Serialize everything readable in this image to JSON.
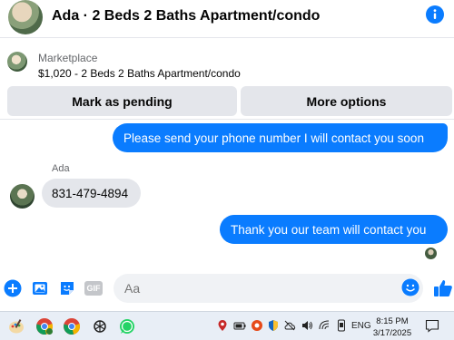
{
  "header": {
    "title": "Ada · 2 Beds 2 Baths Apartment/condo",
    "avatar_icon": "listing-photo-avatar",
    "info_icon": "info-icon"
  },
  "marketplace": {
    "label": "Marketplace",
    "description": "$1,020 - 2 Beds 2 Baths Apartment/condo",
    "buttons": {
      "pending": "Mark as pending",
      "more": "More options"
    }
  },
  "messages": [
    {
      "direction": "outgoing",
      "text": "Please send your phone number I will contact you soon"
    },
    {
      "direction": "incoming",
      "sender": "Ada",
      "text": "831-479-4894"
    },
    {
      "direction": "outgoing",
      "text": "Thank you our team will contact you"
    }
  ],
  "composer": {
    "placeholder": "Aa",
    "icons": [
      "plus-icon",
      "photo-icon",
      "sticker-icon",
      "gif-icon",
      "emoji-icon",
      "like-icon"
    ],
    "gif_label": "GIF"
  },
  "taskbar": {
    "language": "ENG",
    "time": "8:15 PM",
    "date": "3/17/2025"
  },
  "colors": {
    "accent": "#0a7cff",
    "bubble_in": "#e4e6eb",
    "taskbar": "#e8eef6"
  }
}
